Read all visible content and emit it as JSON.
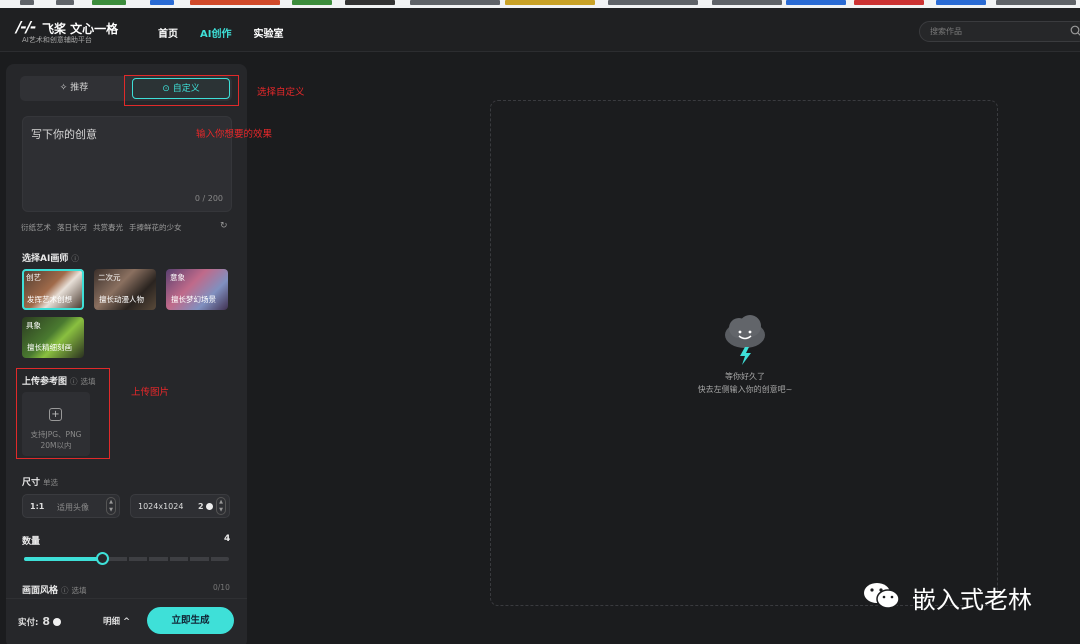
{
  "header": {
    "logo_name": "飞桨 文心一格",
    "logo_sub": "AI艺术和创意辅助平台",
    "nav": [
      "首页",
      "AI创作",
      "实验室"
    ],
    "search_placeholder": "搜索作品"
  },
  "panel": {
    "tabs": {
      "recommend": "推荐",
      "custom": "自定义"
    },
    "prompt": {
      "placeholder": "写下你的创意",
      "counter": "0 / 200"
    },
    "samples": [
      "衍纸艺术",
      "落日长河",
      "共赏春光",
      "手捧鲜花的少女"
    ],
    "artist_section": {
      "title": "选择AI画师"
    },
    "artists": [
      {
        "tag": "创艺",
        "desc": "发挥艺术创想",
        "selected": true
      },
      {
        "tag": "二次元",
        "desc": "擅长动漫人物",
        "selected": false
      },
      {
        "tag": "意象",
        "desc": "擅长梦幻场景",
        "selected": false
      },
      {
        "tag": "具象",
        "desc": "擅长精细刻画",
        "selected": false
      }
    ],
    "upload_section": {
      "title": "上传参考图",
      "hint": "选填"
    },
    "upload": {
      "line1": "支持JPG、PNG",
      "line2": "20M以内"
    },
    "size_section": {
      "title": "尺寸",
      "hint": "单选"
    },
    "ratio": {
      "value": "1:1",
      "desc": "适用头像"
    },
    "resolution": {
      "value": "1024x1024",
      "cost": "2"
    },
    "quantity": {
      "label": "数量",
      "value": "4",
      "max": 10
    },
    "style_section": {
      "title": "画面风格",
      "hint": "选填",
      "counter": "0/10"
    },
    "footer": {
      "points_label": "实付:",
      "points_value": "8",
      "detail": "明细 ^",
      "generate": "立即生成"
    }
  },
  "canvas": {
    "empty_line1": "等你好久了",
    "empty_line2": "快去左侧输入你的创意吧~"
  },
  "annotations": {
    "select_custom": "选择自定义",
    "input_effect": "输入你想要的效果",
    "upload_image": "上传图片",
    "color": "#e02a2a"
  },
  "watermark": "嵌入式老林",
  "colors": {
    "accent": "#3ee0d8",
    "background": "#1b1c1e",
    "panel": "#26272a"
  }
}
